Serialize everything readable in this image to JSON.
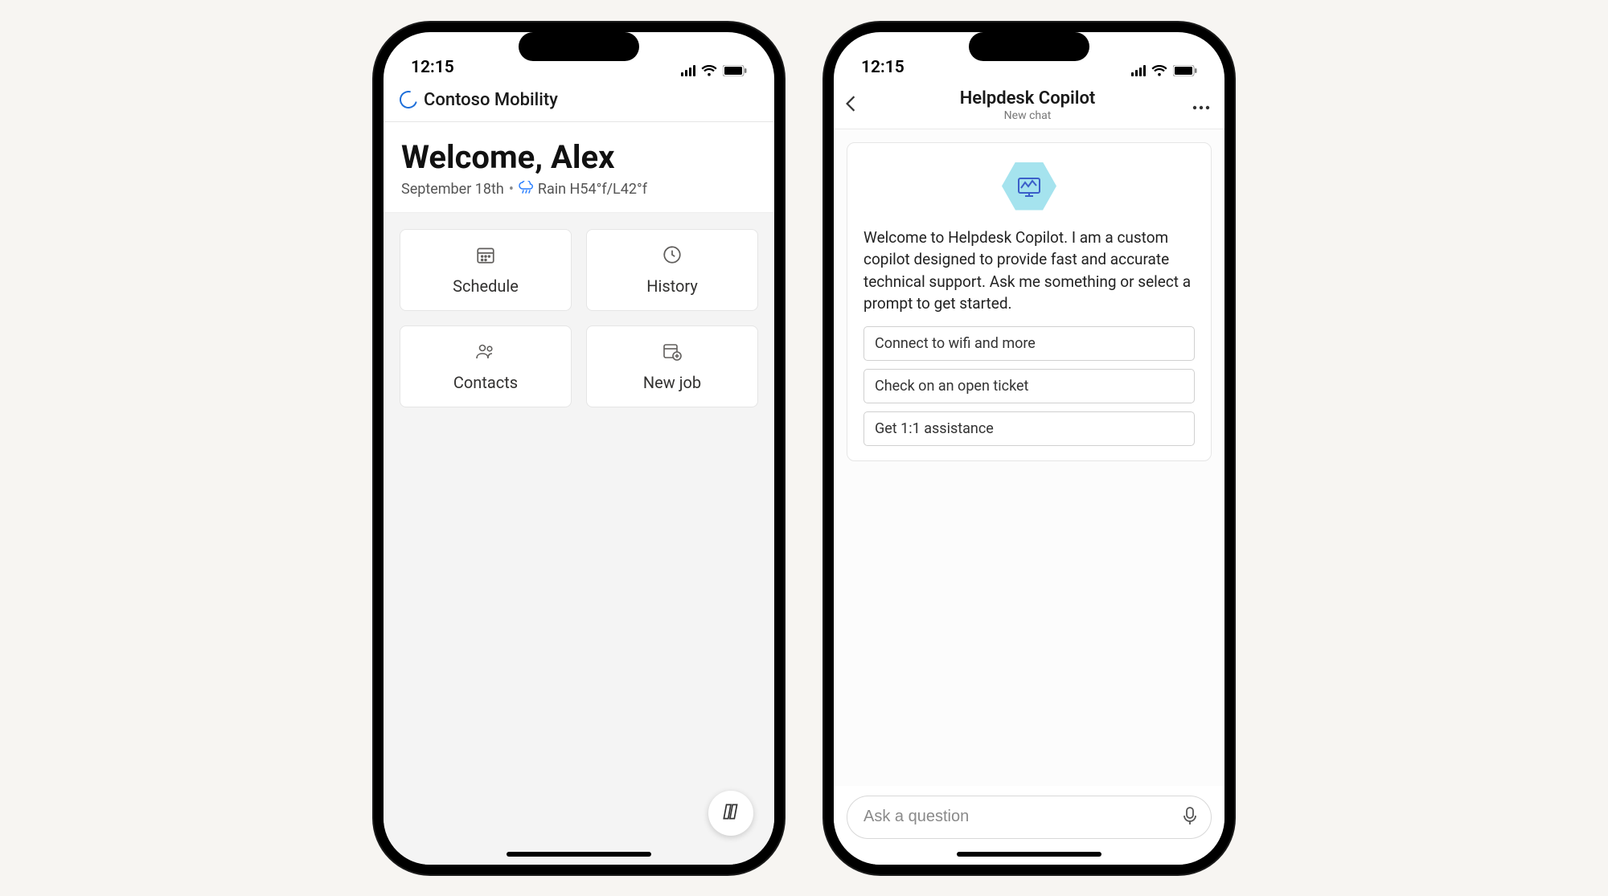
{
  "status": {
    "time": "12:15"
  },
  "phone1": {
    "app_name": "Contoso Mobility",
    "welcome_title": "Welcome, Alex",
    "date": "September 18th",
    "weather": "Rain H54°f/L42°f",
    "tiles": [
      {
        "label": "Schedule"
      },
      {
        "label": "History"
      },
      {
        "label": "Contacts"
      },
      {
        "label": "New job"
      }
    ]
  },
  "phone2": {
    "title": "Helpdesk Copilot",
    "subtitle": "New chat",
    "intro": "Welcome to Helpdesk Copilot. I am a custom copilot designed to provide fast and accurate technical support. Ask me something or select a prompt to get started.",
    "prompts": [
      "Connect to wifi and more",
      "Check on an open ticket",
      "Get 1:1 assistance"
    ],
    "input_placeholder": "Ask a question"
  }
}
